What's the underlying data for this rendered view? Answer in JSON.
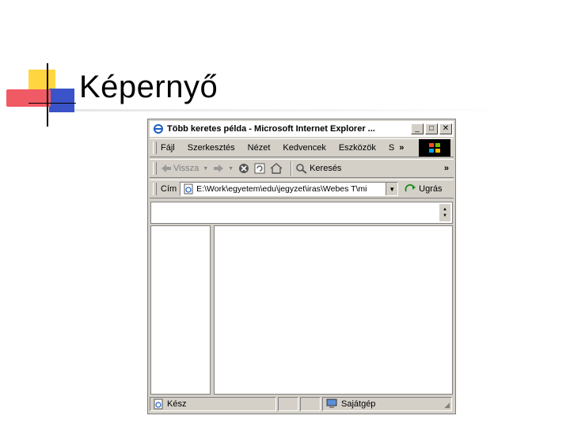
{
  "slide": {
    "title": "Képernyő"
  },
  "window": {
    "title": "Több keretes példa - Microsoft Internet Explorer ...",
    "controls": {
      "minimize": "_",
      "maximize": "□",
      "close": "✕"
    }
  },
  "menu": {
    "items": [
      "Fájl",
      "Szerkesztés",
      "Nézet",
      "Kedvencek",
      "Eszközök",
      "S"
    ],
    "more": "»"
  },
  "toolbar": {
    "back_label": "Vissza",
    "search_label": "Keresés",
    "more": "»"
  },
  "address": {
    "label": "Cím",
    "value": "E:\\Work\\egyetem\\edu\\jegyzet\\iras\\Webes T\\mi",
    "go_label": "Ugrás"
  },
  "status": {
    "text": "Kész",
    "zone": "Sajátgép"
  },
  "colors": {
    "chrome": "#d4d0c8",
    "accent_yellow": "#ffd640",
    "accent_blue": "#3a53c9",
    "accent_red": "#f05a64"
  }
}
